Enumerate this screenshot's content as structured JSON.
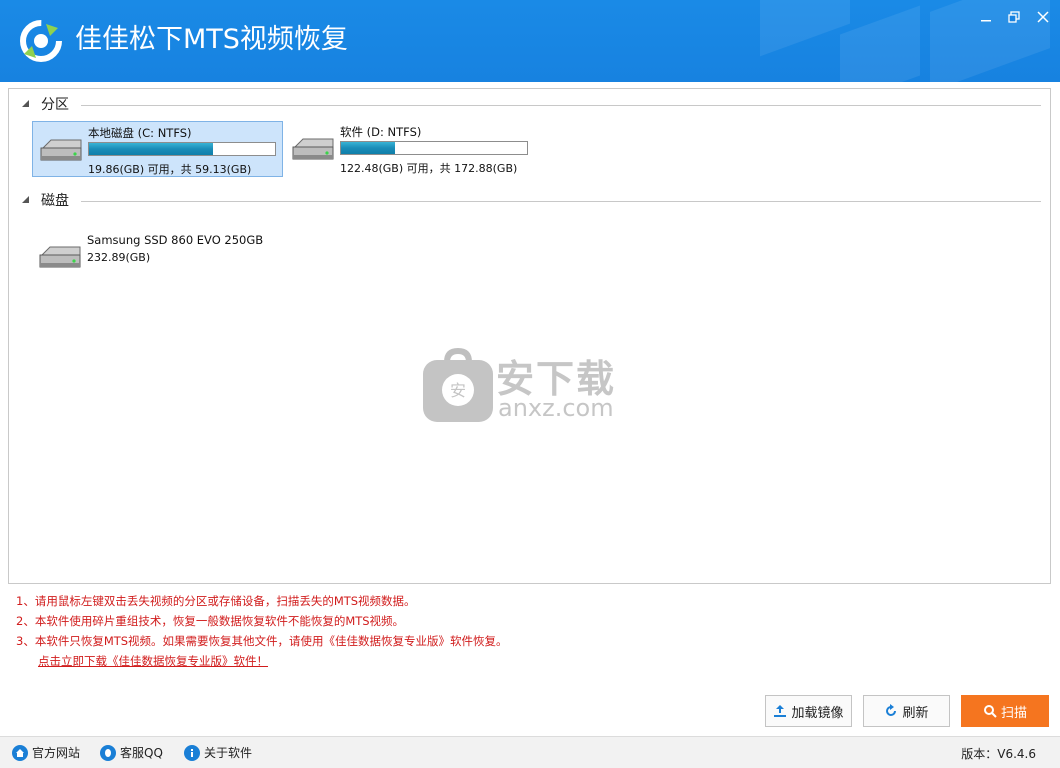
{
  "app": {
    "title": "佳佳松下MTS视频恢复"
  },
  "window_controls": {
    "minimize": "minimize-icon",
    "maximize": "restore-icon",
    "close": "close-icon"
  },
  "sections": {
    "partitions_label": "分区",
    "disks_label": "磁盘"
  },
  "partitions": [
    {
      "name": "本地磁盘 (C: NTFS)",
      "size": "19.86(GB) 可用，共 59.13(GB)",
      "used_fraction": 0.664,
      "selected": true
    },
    {
      "name": "软件 (D: NTFS)",
      "size": "122.48(GB) 可用，共 172.88(GB)",
      "used_fraction": 0.292,
      "selected": false
    }
  ],
  "disks": [
    {
      "name": "Samsung SSD 860 EVO 250GB",
      "size": "232.89(GB)"
    }
  ],
  "watermark": {
    "brand": "安下载",
    "domain": "anxz.com"
  },
  "notes": [
    "1、请用鼠标左键双击丢失视频的分区或存储设备，扫描丢失的MTS视频数据。",
    "2、本软件使用碎片重组技术，恢复一般数据恢复软件不能恢复的MTS视频。",
    "3、本软件只恢复MTS视频。如果需要恢复其他文件，请使用《佳佳数据恢复专业版》软件恢复。"
  ],
  "download_link": "点击立即下载《佳佳数据恢复专业版》软件！",
  "buttons": {
    "load_image": "加载镜像",
    "refresh": "刷新",
    "scan": "扫描"
  },
  "footer": {
    "website": "官方网站",
    "qq": "客服QQ",
    "about": "关于软件",
    "version": "版本：V6.4.6"
  },
  "colors": {
    "titlebar": "#1782e0",
    "accent_orange": "#f5751f",
    "note_red": "#d11c1c",
    "selected_bg": "#cde4fb"
  }
}
